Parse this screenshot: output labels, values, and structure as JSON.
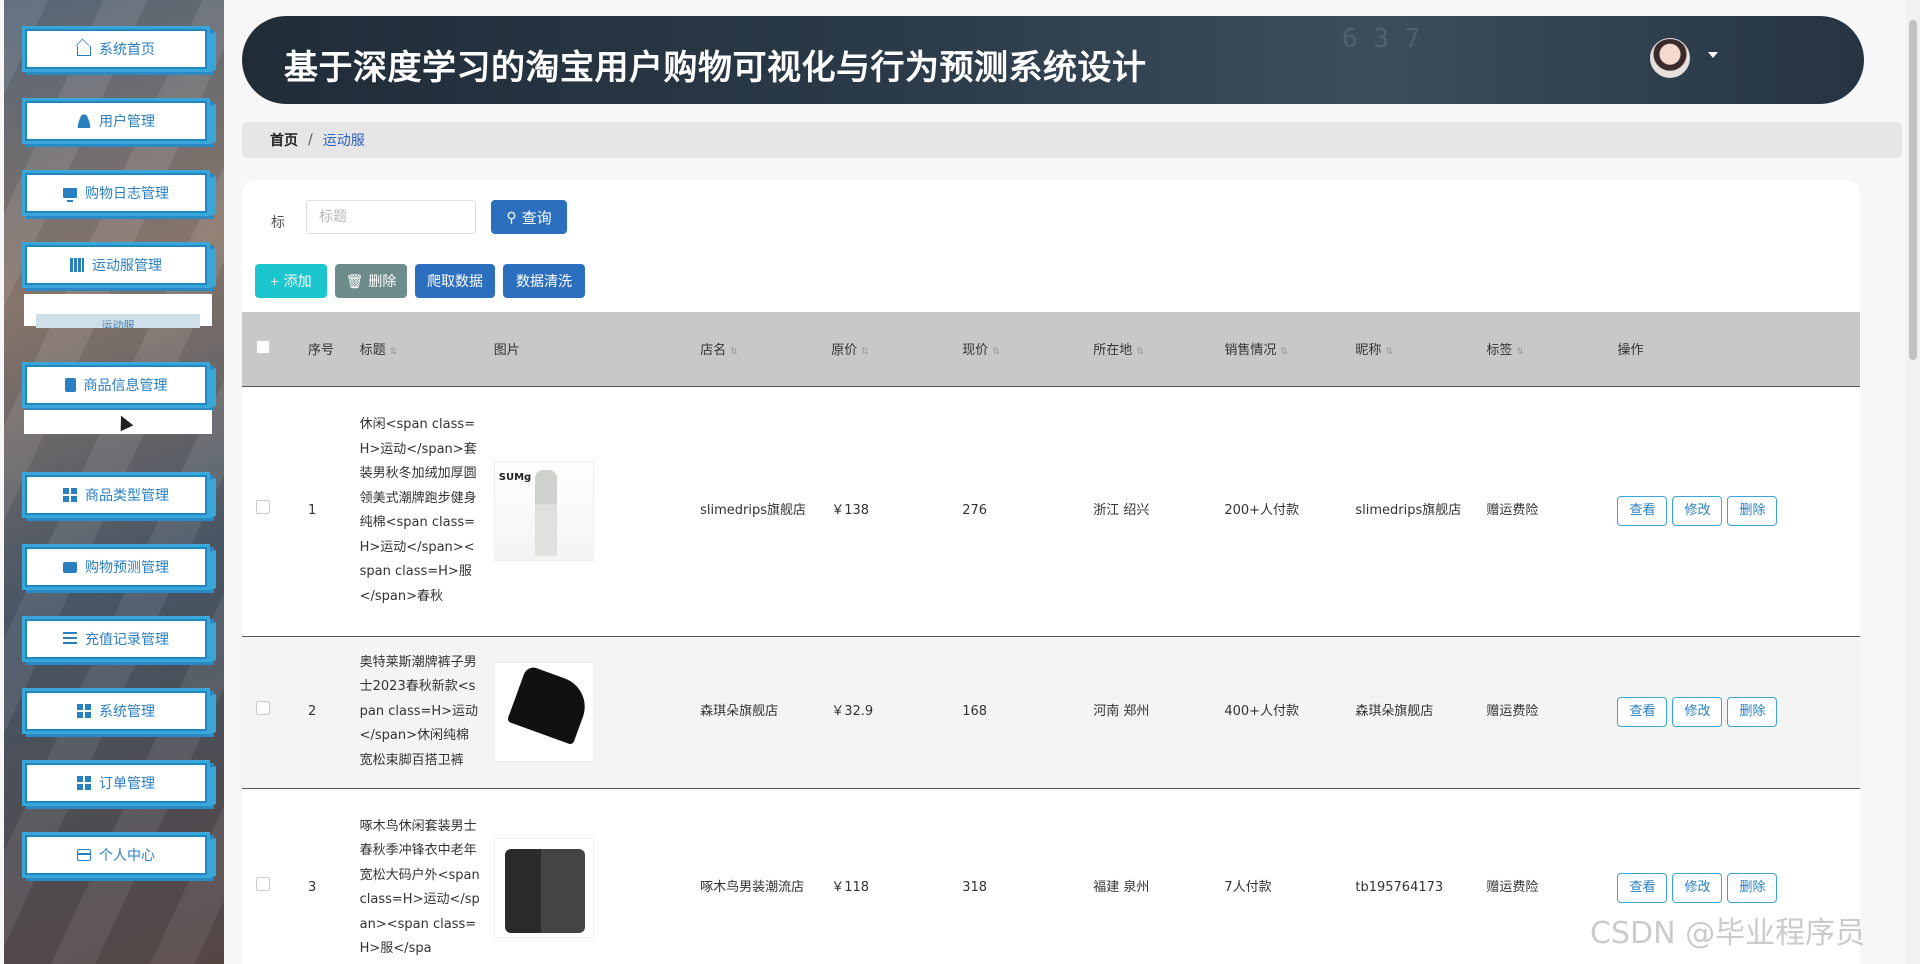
{
  "sidebar": {
    "items": [
      {
        "label": "系统首页",
        "icon": "home-icon"
      },
      {
        "label": "用户管理",
        "icon": "user-icon"
      },
      {
        "label": "购物日志管理",
        "icon": "monitor-icon"
      },
      {
        "label": "运动服管理",
        "icon": "books-icon"
      },
      {
        "label": "商品信息管理",
        "icon": "clipboard-icon"
      },
      {
        "label": "商品类型管理",
        "icon": "grid-icon"
      },
      {
        "label": "购物预测管理",
        "icon": "chat-icon"
      },
      {
        "label": "充值记录管理",
        "icon": "sliders-icon"
      },
      {
        "label": "系统管理",
        "icon": "grid-icon"
      },
      {
        "label": "订单管理",
        "icon": "grid-icon"
      },
      {
        "label": "个人中心",
        "icon": "card-icon"
      }
    ],
    "submenu_label": "运动服"
  },
  "header": {
    "title": "基于深度学习的淘宝用户购物可视化与行为预测系统设计",
    "deco_text": "6 3 7"
  },
  "breadcrumb": {
    "home": "首页",
    "separator": "/",
    "current": "运动服"
  },
  "search": {
    "label": "标",
    "placeholder": "标题",
    "query_label": "查询"
  },
  "toolbar": {
    "add_label": "添加",
    "delete_label": "删除",
    "crawl_label": "爬取数据",
    "clean_label": "数据清洗"
  },
  "table": {
    "headers": {
      "index": "序号",
      "title": "标题",
      "image": "图片",
      "shop": "店名",
      "orig_price": "原价",
      "price": "现价",
      "location": "所在地",
      "sales": "销售情况",
      "nickname": "昵称",
      "tag": "标签",
      "actions": "操作"
    },
    "rows": [
      {
        "index": "1",
        "title": "休闲<span class=H>运动</span>套装男秋冬加绒加厚圆领美式潮牌跑步健身纯棉<span class=H>运动</span><span class=H>服</span>春秋",
        "image_logo": "SUMg",
        "shop": "slimedrips旗舰店",
        "orig_price": "￥138",
        "price": "276",
        "location": "浙江 绍兴",
        "sales": "200+人付款",
        "nickname": "slimedrips旗舰店",
        "tag": "赠运费险"
      },
      {
        "index": "2",
        "title": "奥特莱斯潮牌裤子男士2023春秋新款<span class=H>运动</span>休闲纯棉宽松束脚百搭卫裤",
        "image_logo": "",
        "shop": "森琪朵旗舰店",
        "orig_price": "￥32.9",
        "price": "168",
        "location": "河南 郑州",
        "sales": "400+人付款",
        "nickname": "森琪朵旗舰店",
        "tag": "赠运费险"
      },
      {
        "index": "3",
        "title": "啄木鸟休闲套装男士春秋季冲锋衣中老年宽松大码户外<span class=H>运动</span><span class=H>服</spa",
        "image_logo": "",
        "shop": "啄木鸟男装潮流店",
        "orig_price": "￥118",
        "price": "318",
        "location": "福建 泉州",
        "sales": "7人付款",
        "nickname": "tb195764173",
        "tag": "赠运费险"
      }
    ],
    "action_labels": {
      "view": "查看",
      "edit": "修改",
      "delete": "删除"
    }
  },
  "watermark": "CSDN @毕业程序员",
  "colors": {
    "accent": "#2d6fbf",
    "sidebar_border": "#3aa6d8",
    "add_button": "#1cc6cf",
    "delete_button": "#6f8c8c",
    "header_bg": "#202c38"
  }
}
